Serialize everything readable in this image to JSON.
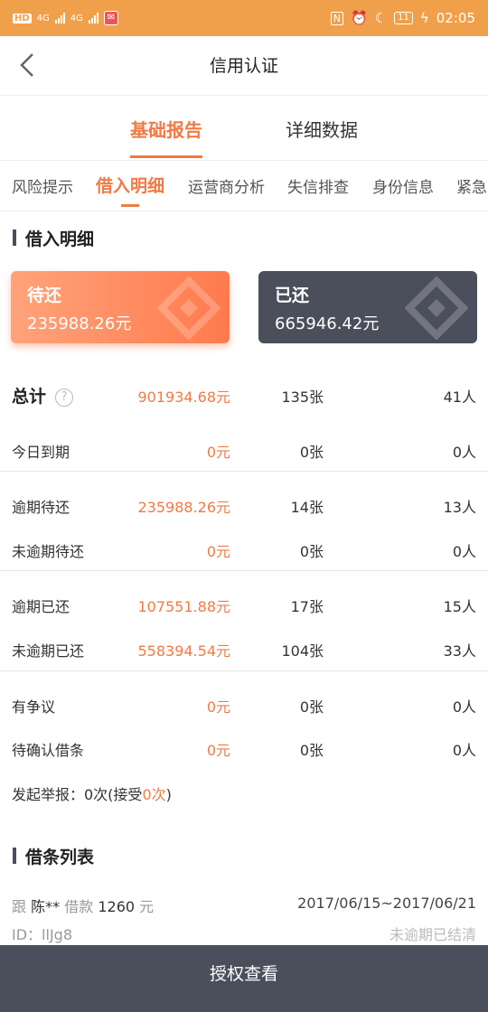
{
  "statusbar": {
    "left_badges": [
      "HD",
      "4G",
      "4G"
    ],
    "right": {
      "nfc": "N",
      "battery": "11",
      "time": "02:05"
    },
    "color": "#f0a04a"
  },
  "navbar": {
    "back_icon": "chevron-left-icon",
    "title": "信用认证"
  },
  "top_tabs": [
    {
      "label": "基础报告",
      "active": true
    },
    {
      "label": "详细数据",
      "active": false
    }
  ],
  "sub_tabs": [
    {
      "label": "风险提示"
    },
    {
      "label": "借入明细",
      "active": true
    },
    {
      "label": "运营商分析"
    },
    {
      "label": "失信排查"
    },
    {
      "label": "身份信息"
    },
    {
      "label": "紧急"
    }
  ],
  "borrow_section": {
    "title": "借入明细",
    "cards": {
      "pending": {
        "label": "待还",
        "amount": "235988.26元"
      },
      "paid": {
        "label": "已还",
        "amount": "665946.42元"
      }
    },
    "rows": [
      {
        "label": "总计",
        "amount": "901934.68元",
        "count": "135张",
        "people": "41人"
      },
      {
        "label": "今日到期",
        "amount": "0元",
        "count": "0张",
        "people": "0人"
      },
      {
        "label": "逾期待还",
        "amount": "235988.26元",
        "count": "14张",
        "people": "13人"
      },
      {
        "label": "未逾期待还",
        "amount": "0元",
        "count": "0张",
        "people": "0人"
      },
      {
        "label": "逾期已还",
        "amount": "107551.88元",
        "count": "17张",
        "people": "15人"
      },
      {
        "label": "未逾期已还",
        "amount": "558394.54元",
        "count": "104张",
        "people": "33人"
      },
      {
        "label": "有争议",
        "amount": "0元",
        "count": "0张",
        "people": "0人"
      },
      {
        "label": "待确认借条",
        "amount": "0元",
        "count": "0张",
        "people": "0人"
      }
    ],
    "report": {
      "prefix": "发起举报：0次(接受",
      "accepted": "0次",
      "suffix": ")"
    }
  },
  "loan_list": {
    "title": "借条列表",
    "items": [
      {
        "with_label": "跟",
        "name": "陈**",
        "borrow_label": "借款",
        "amount": "1260",
        "unit": "元",
        "period": "2017/06/15~2017/06/21",
        "id_label": "ID：",
        "id": "llJg8",
        "status": "未逾期已结清"
      }
    ]
  },
  "bottom_button": {
    "label": "授权查看"
  },
  "colors": {
    "accent": "#f07a45",
    "dark": "#4b4f5c"
  }
}
